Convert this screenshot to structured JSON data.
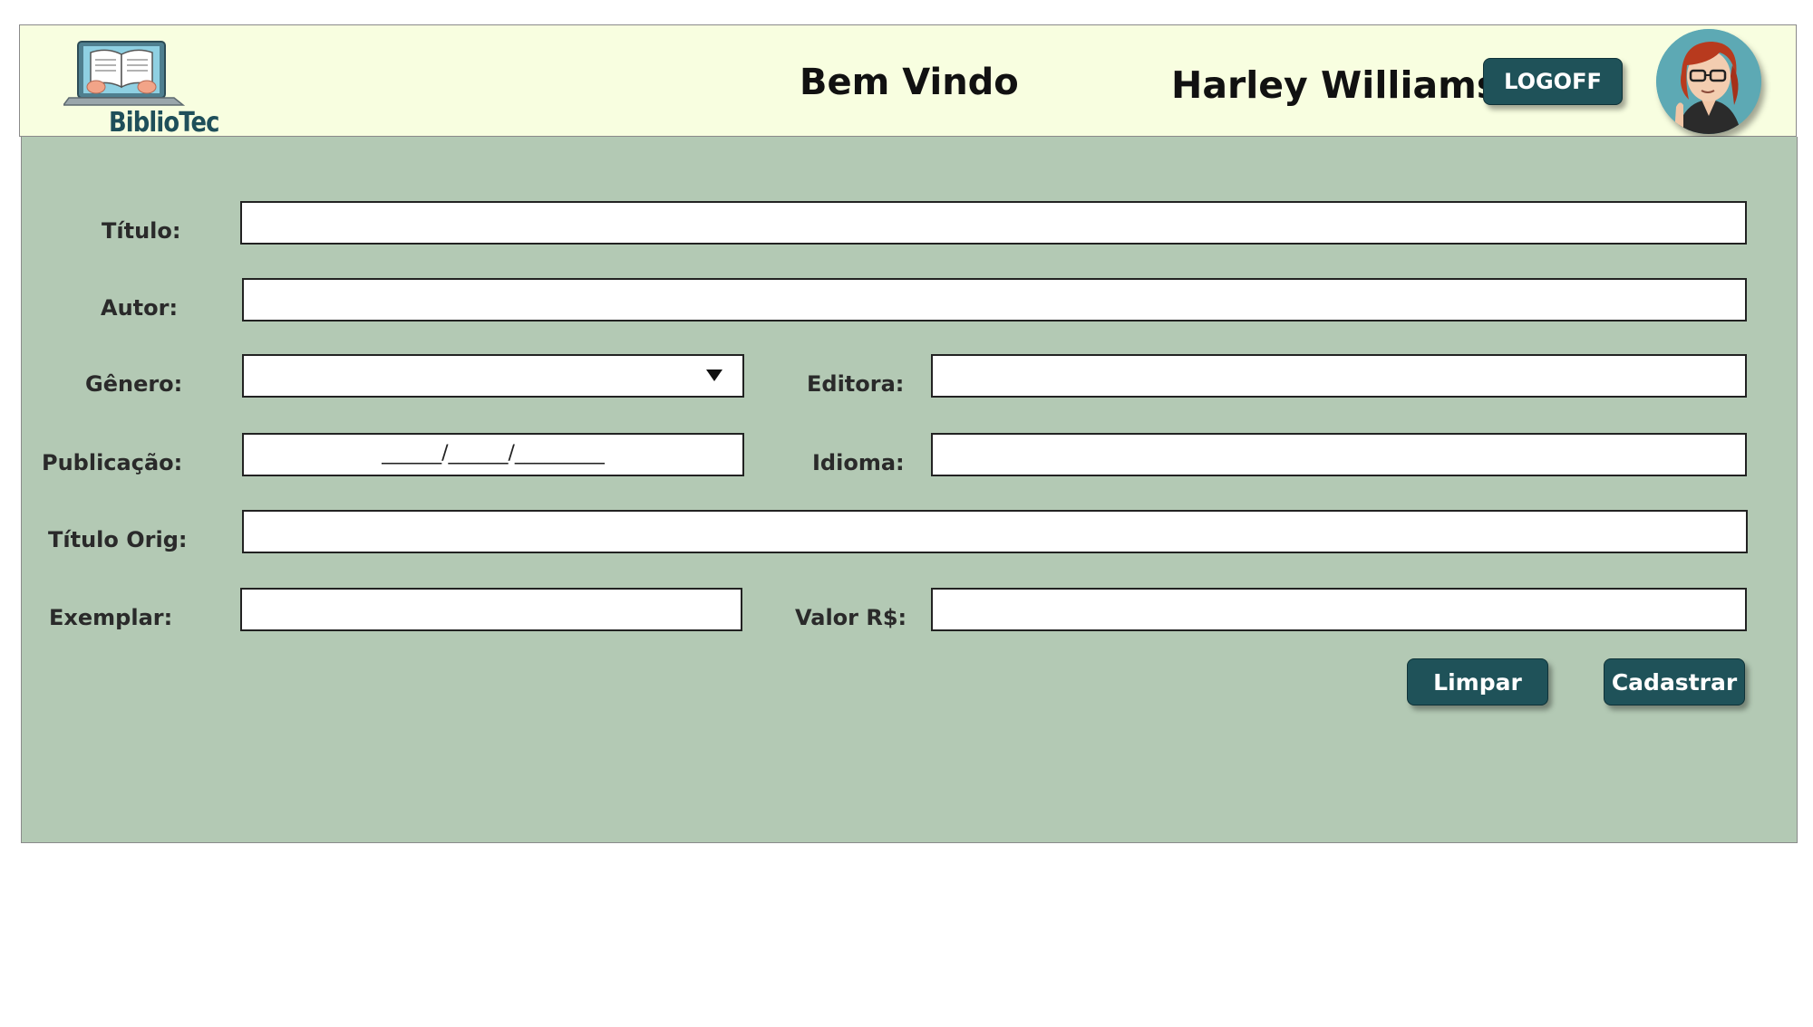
{
  "app": {
    "logo_text": "BiblioTec"
  },
  "header": {
    "welcome": "Bem Vindo",
    "user_name": "Harley Williams",
    "logoff_label": "LOGOFF"
  },
  "form": {
    "titulo_label": "Título:",
    "autor_label": "Autor:",
    "genero_label": "Gênero:",
    "editora_label": "Editora:",
    "publicacao_label": "Publicação:",
    "publicacao_mask": "______/______/_________",
    "idioma_label": "Idioma:",
    "titulo_orig_label": "Título Orig:",
    "exemplar_label": "Exemplar:",
    "valor_label": "Valor R$:",
    "genero_selected": "",
    "titulo_value": "",
    "autor_value": "",
    "editora_value": "",
    "idioma_value": "",
    "titulo_orig_value": "",
    "exemplar_value": "",
    "valor_value": ""
  },
  "actions": {
    "limpar_label": "Limpar",
    "cadastrar_label": "Cadastrar"
  },
  "icons": {
    "logo": "book-laptop-logo-icon",
    "avatar": "user-avatar-icon",
    "dropdown": "chevron-down-icon"
  },
  "colors": {
    "header_bg": "#f8fee0",
    "main_bg": "#b3c9b4",
    "button_bg": "#1f5259",
    "logo_text": "#1f4f5a"
  }
}
